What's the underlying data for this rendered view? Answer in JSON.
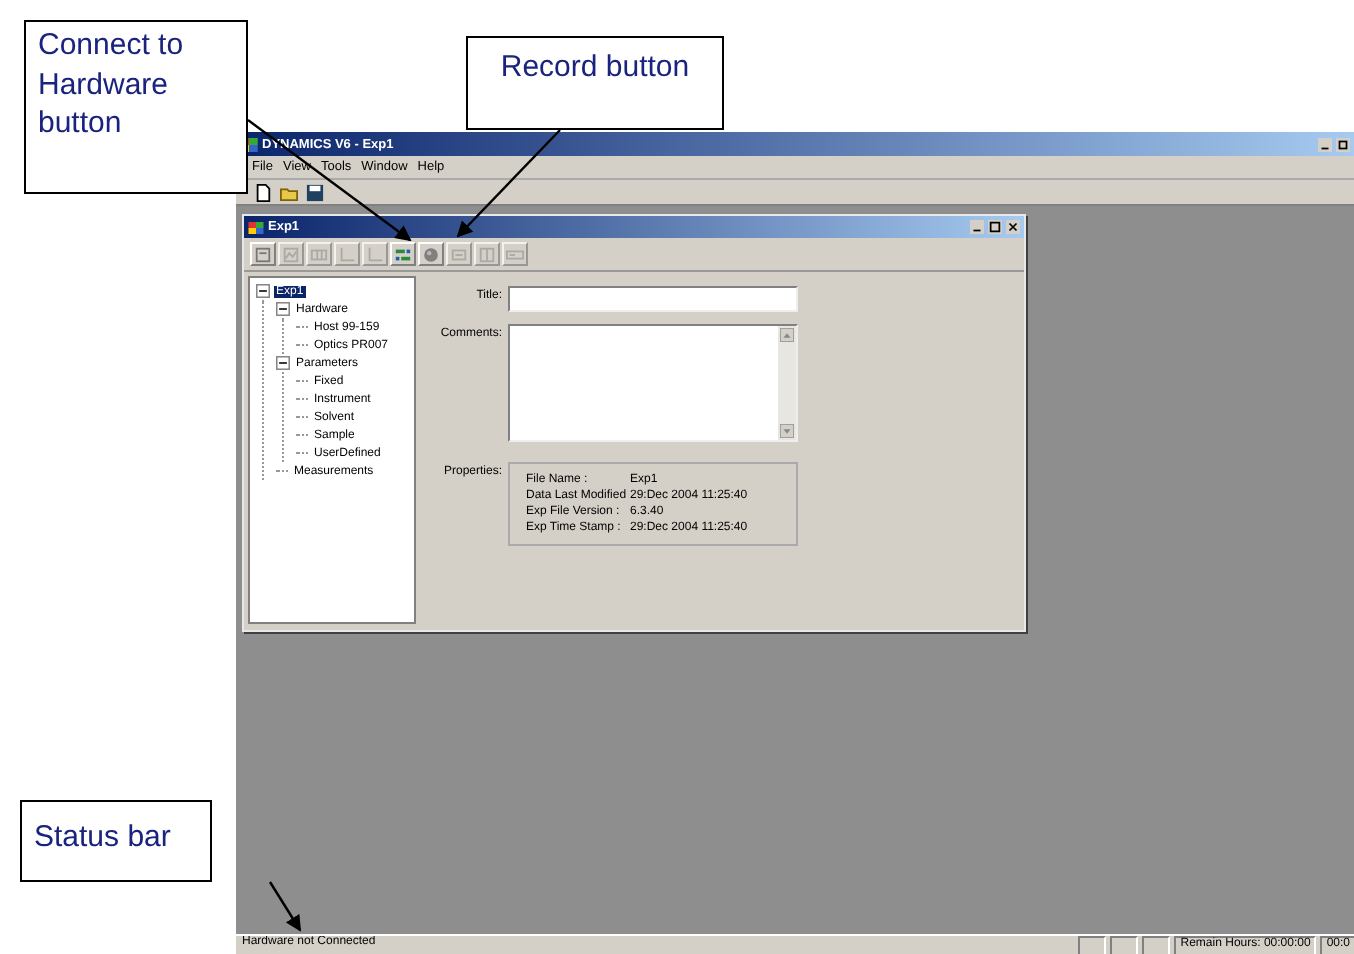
{
  "callouts": [
    {
      "text": "Connect to Hardware button",
      "kind": "connect"
    },
    {
      "text": "Record button",
      "kind": "record"
    },
    {
      "text": "Status bar",
      "kind": "status"
    }
  ],
  "app": {
    "title": "DYNAMICS V6 - Exp1",
    "menu": [
      "File",
      "View",
      "Tools",
      "Window",
      "Help"
    ],
    "toolbar": [
      {
        "kind": "new"
      },
      {
        "kind": "open"
      },
      {
        "kind": "save"
      }
    ]
  },
  "child_window": {
    "title": "Exp1",
    "toolbar": [
      {
        "kind": "doc",
        "disabled": false
      },
      {
        "kind": "graph",
        "disabled": true
      },
      {
        "kind": "table",
        "disabled": true
      },
      {
        "kind": "chart",
        "disabled": true
      },
      {
        "kind": "axis",
        "disabled": true
      },
      {
        "kind": "connect",
        "disabled": false
      },
      {
        "kind": "record",
        "disabled": false
      },
      {
        "kind": "list",
        "disabled": true
      },
      {
        "kind": "columns",
        "disabled": true
      },
      {
        "kind": "panel",
        "disabled": true
      }
    ],
    "tree": [
      {
        "label": "Exp1",
        "selected": true,
        "expanded": true,
        "children": [
          {
            "label": "Hardware",
            "selected": false,
            "expanded": true,
            "children": [
              {
                "label": "Host 99-159",
                "selected": false
              },
              {
                "label": "Optics PR007",
                "selected": false
              }
            ]
          },
          {
            "label": "Parameters",
            "selected": false,
            "expanded": true,
            "children": [
              {
                "label": "Fixed",
                "selected": false
              },
              {
                "label": "Instrument",
                "selected": false
              },
              {
                "label": "Solvent",
                "selected": false
              },
              {
                "label": "Sample",
                "selected": false
              },
              {
                "label": "UserDefined",
                "selected": false
              }
            ]
          },
          {
            "label": "Measurements",
            "selected": false
          }
        ]
      }
    ],
    "title_label": "Title:",
    "comments_label": "Comments:",
    "properties_label": "Properties:",
    "properties": [
      {
        "label": "File Name :",
        "value": "Exp1"
      },
      {
        "label": "Data Last Modified",
        "value": "29:Dec 2004 11:25:40"
      },
      {
        "label": "Exp File Version :",
        "value": "6.3.40"
      },
      {
        "label": "Exp Time Stamp :",
        "value": "29:Dec 2004 11:25:40"
      }
    ]
  },
  "status_bar": {
    "message": "Hardware not Connected",
    "remain": "Remain Hours: 00:00:00",
    "extra": "00:0"
  }
}
